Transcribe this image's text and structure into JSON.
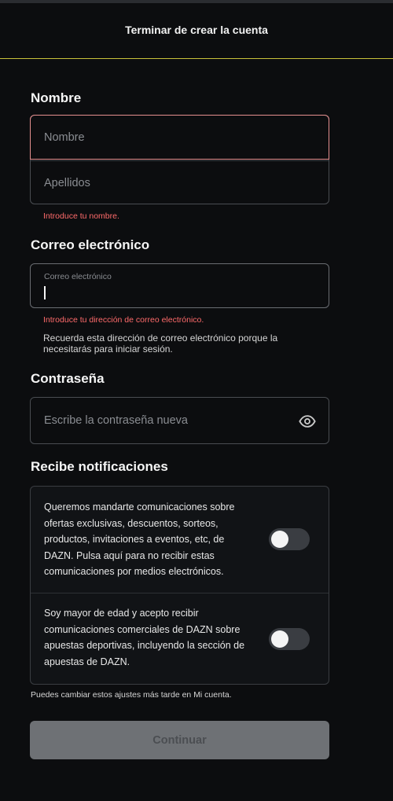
{
  "header": {
    "title": "Terminar de crear la cuenta"
  },
  "name_section": {
    "label": "Nombre",
    "first_name_placeholder": "Nombre",
    "last_name_placeholder": "Apellidos",
    "error": "Introduce tu nombre."
  },
  "email_section": {
    "label": "Correo electrónico",
    "field_label": "Correo electrónico",
    "value": "",
    "error": "Introduce tu dirección de correo electrónico.",
    "help": "Recuerda esta dirección de correo electrónico porque la necesitarás para iniciar sesión."
  },
  "password_section": {
    "label": "Contraseña",
    "placeholder": "Escribe la contraseña nueva",
    "icon": "eye-icon"
  },
  "notifications": {
    "label": "Recibe notificaciones",
    "items": [
      {
        "text": "Queremos mandarte comunicaciones sobre ofertas exclusivas, descuentos, sorteos, productos, invitaciones a eventos, etc, de DAZN. Pulsa aquí para no recibir estas comunicaciones por medios electrónicos.",
        "enabled": false
      },
      {
        "text": "Soy mayor de edad y acepto recibir comunicaciones comerciales de DAZN sobre apuestas deportivas, incluyendo la sección de apuestas de DAZN.",
        "enabled": false
      }
    ],
    "footnote": "Puedes cambiar estos ajustes más tarde en Mi cuenta."
  },
  "actions": {
    "continue_label": "Continuar"
  },
  "colors": {
    "background": "#0c0d0f",
    "accent_line": "#c8c23a",
    "error": "#ff6b6b",
    "button_disabled": "#6e7175"
  }
}
